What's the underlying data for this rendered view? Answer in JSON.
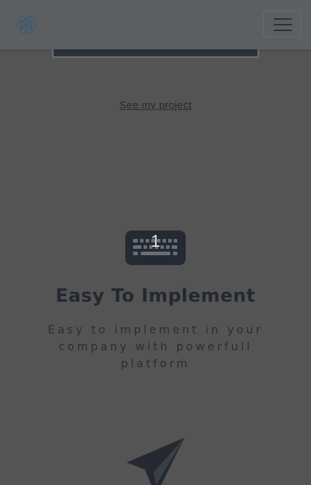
{
  "navbar": {
    "logo_icon": "react-atom-icon",
    "toggler_icon": "hamburger-menu-icon"
  },
  "hero": {
    "project_link_label": "See my project"
  },
  "feature": {
    "icon": "keyboard-icon",
    "number": "1",
    "title": "Easy To Implement",
    "description": "Easy to implement in your company with powerfull platform"
  },
  "next_feature": {
    "icon": "paper-plane-icon"
  },
  "colors": {
    "background": "#545454",
    "navbar": "#5c5f61",
    "text_dark": "#242830",
    "accent_logo": "#3d5a73"
  }
}
